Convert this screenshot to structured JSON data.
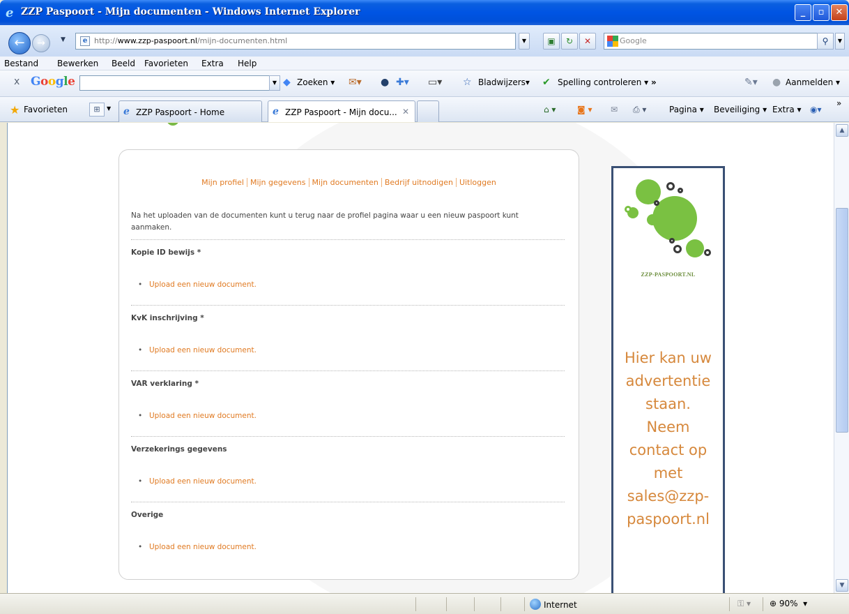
{
  "window": {
    "title": "ZZP Paspoort - Mijn documenten - Windows Internet Explorer"
  },
  "address": {
    "domain": "www.zzp-paspoort.nl",
    "prefix": "http://",
    "path": "/mijn-documenten.html",
    "search_placeholder": "Google"
  },
  "menu": {
    "items": [
      "Bestand",
      "Bewerken",
      "Beeld",
      "Favorieten",
      "Extra",
      "Help"
    ]
  },
  "google_toolbar": {
    "logo": "Google",
    "search_label": "Zoeken",
    "bookmarks_label": "Bladwijzers",
    "spelling_label": "Spelling controleren",
    "more": "»",
    "signin_label": "Aanmelden"
  },
  "tabs": {
    "favorites_label": "Favorieten",
    "items": [
      {
        "label": "ZZP Paspoort - Home",
        "active": false
      },
      {
        "label": "ZZP Paspoort - Mijn docu...",
        "active": true
      }
    ],
    "command_bar": {
      "page": "Pagina",
      "security": "Beveiliging",
      "extra": "Extra"
    }
  },
  "page": {
    "nav": [
      "Mijn profiel",
      "Mijn gegevens",
      "Mijn documenten",
      "Bedrijf uitnodigen",
      "Uitloggen"
    ],
    "intro": "Na het uploaden van de documenten kunt u terug naar de profiel pagina waar u een nieuw paspoort kunt aanmaken.",
    "sections": [
      {
        "title": "Kopie ID bewijs *",
        "link": "Upload een nieuw document."
      },
      {
        "title": "KvK inschrijving *",
        "link": "Upload een nieuw document."
      },
      {
        "title": "VAR verklaring *",
        "link": "Upload een nieuw document."
      },
      {
        "title": "Verzekerings gegevens",
        "link": "Upload een nieuw document."
      },
      {
        "title": "Overige",
        "link": "Upload een nieuw document."
      }
    ]
  },
  "ad": {
    "brand": "ZZP-PASPOORT.NL",
    "lines": [
      "Hier kan uw",
      "advertentie",
      "staan.",
      "Neem",
      "contact op",
      "met",
      "sales@zzp-",
      "paspoort.nl"
    ]
  },
  "status": {
    "zone": "Internet",
    "zoom": "90%"
  }
}
